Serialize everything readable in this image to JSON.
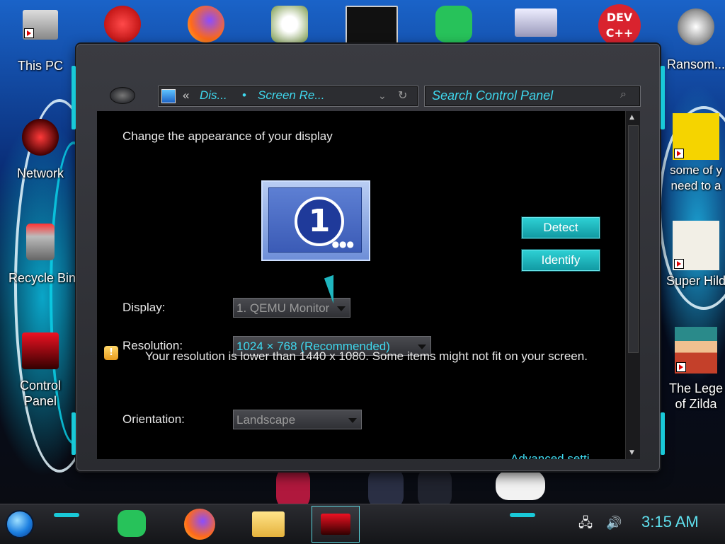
{
  "desktop": {
    "icons_left": [
      {
        "label": "This PC",
        "icon": "computer-icon"
      },
      {
        "label": "Network",
        "icon": "network-icon"
      },
      {
        "label": "Recycle Bin",
        "icon": "recycle-bin-icon"
      },
      {
        "label": "Control\nPanel",
        "icon": "control-panel-icon"
      }
    ],
    "icons_top": [
      {
        "icon": "red-creature-icon"
      },
      {
        "icon": "firefox-icon"
      },
      {
        "icon": "plants-vs-zombies-icon"
      },
      {
        "icon": "terminal-icon"
      },
      {
        "icon": "chat-icon"
      },
      {
        "icon": "network-drive-icon"
      },
      {
        "icon": "dev-cpp-icon",
        "label": "DEV C++"
      }
    ],
    "icons_right": [
      {
        "label": "Ransom...",
        "icon": "skull-icon"
      },
      {
        "label": "some of y\nneed to a",
        "icon": "scooby-icon"
      },
      {
        "label": "Super Hild",
        "icon": "pixel-cat-icon"
      },
      {
        "label": "The Lege\nof Zilda",
        "icon": "pixel-hero-icon"
      }
    ]
  },
  "window": {
    "breadcrumb": {
      "prefix": "«",
      "item1": "Dis...",
      "separator": "•",
      "item2": "Screen Re..."
    },
    "search_placeholder": "Search Control Panel",
    "heading": "Change the appearance of your display",
    "monitor_number": "1",
    "detect_label": "Detect",
    "identify_label": "Identify",
    "display_label": "Display:",
    "display_value": "1. QEMU Monitor",
    "resolution_label": "Resolution:",
    "resolution_value": "1024 × 768 (Recommended)",
    "warning_text": "Your resolution is lower than 1440 x 1080. Some items might not fit on your screen.",
    "orientation_label": "Orientation:",
    "orientation_value": "Landscape",
    "advanced_link": "Advanced setti..."
  },
  "taskbar": {
    "apps": [
      {
        "icon": "chat-icon"
      },
      {
        "icon": "firefox-icon"
      },
      {
        "icon": "file-explorer-icon"
      },
      {
        "icon": "control-panel-icon",
        "active": true
      }
    ],
    "clock": "3:15 AM"
  },
  "colors": {
    "accent": "#19c9d8",
    "link": "#3fd8ee",
    "button": "#1fb6bf"
  }
}
